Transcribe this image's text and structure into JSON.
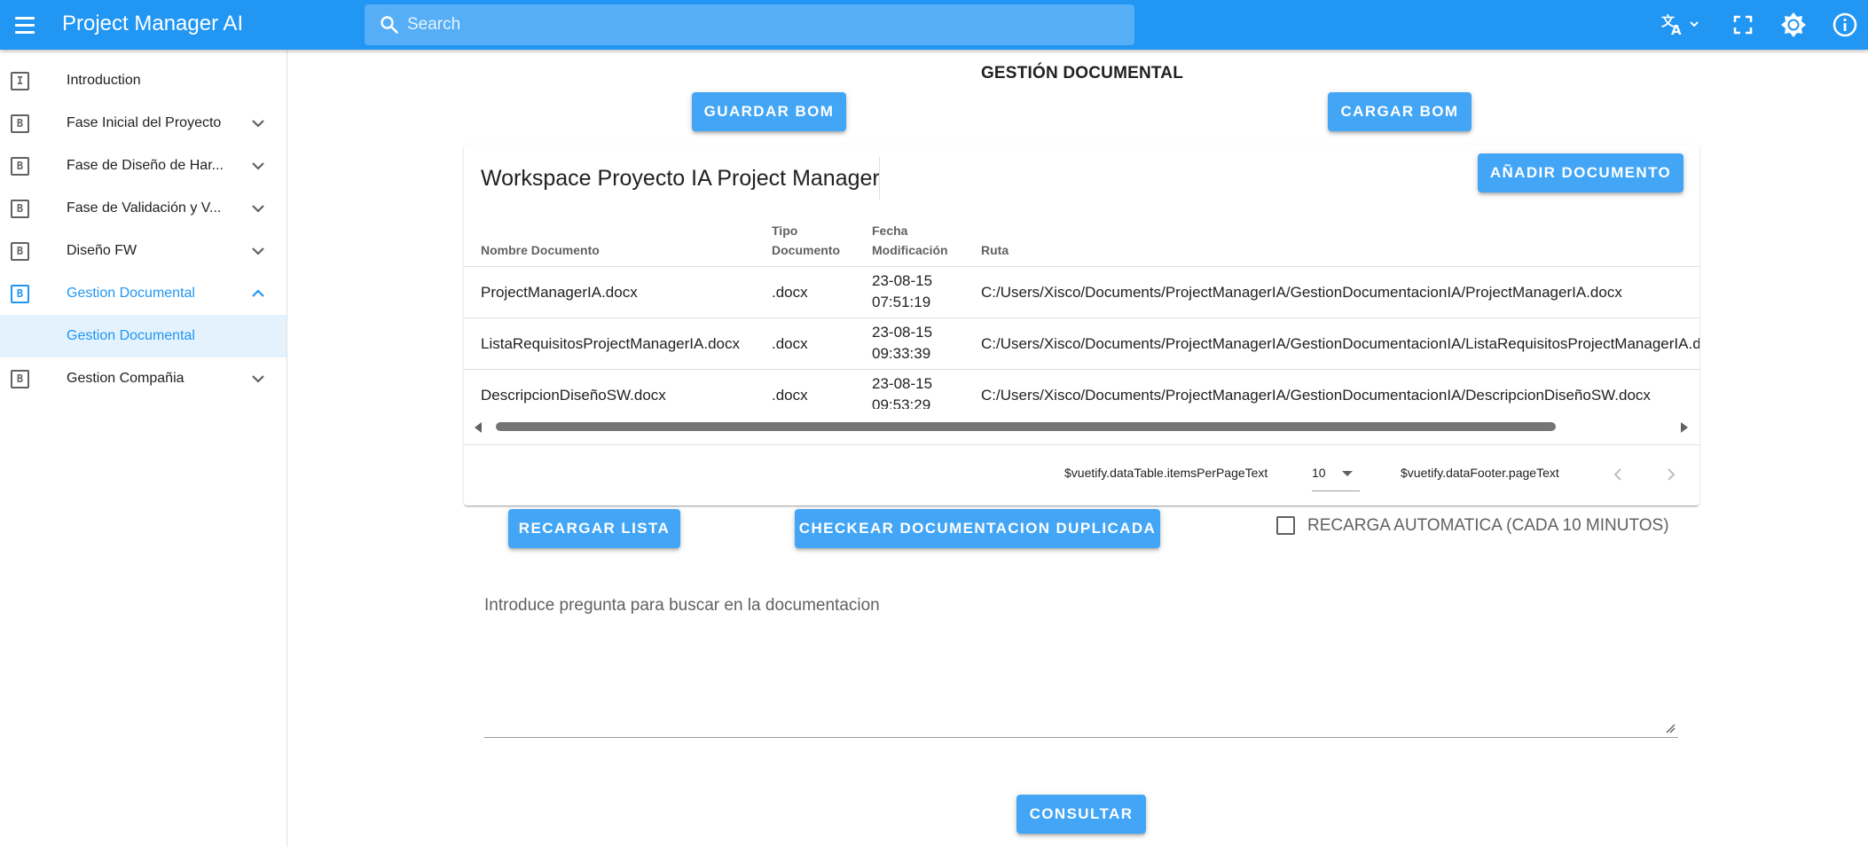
{
  "appbar": {
    "title": "Project Manager AI",
    "search_placeholder": "Search",
    "accent_color": "#2196f3",
    "icons": [
      "menu-icon",
      "translate-icon",
      "fullscreen-icon",
      "brightness-icon",
      "info-icon"
    ]
  },
  "sidebar": {
    "items": [
      {
        "icon": "I",
        "label": "Introduction"
      },
      {
        "icon": "B",
        "label": "Fase Inicial del Proyecto"
      },
      {
        "icon": "B",
        "label": "Fase de Diseño de Har..."
      },
      {
        "icon": "B",
        "label": "Fase de Validación y V..."
      },
      {
        "icon": "B",
        "label": "Diseño FW"
      },
      {
        "icon": "B",
        "label": "Gestion Documental"
      },
      {
        "icon": "B",
        "label": "Gestion Compañia"
      }
    ],
    "sub_item": {
      "label": "Gestion Documental"
    }
  },
  "main": {
    "title": "GESTIÓN DOCUMENTAL",
    "save_bom_label": "GUARDAR BOM",
    "load_bom_label": "CARGAR BOM",
    "workspace_title": "Workspace Proyecto IA Project Manager",
    "add_document_label": "AÑADIR DOCUMENTO",
    "table": {
      "headers": {
        "name": "Nombre Documento",
        "type_l1": "Tipo",
        "type_l2": "Documento",
        "date_l1": "Fecha",
        "date_l2": "Modificación",
        "path": "Ruta"
      },
      "rows": [
        {
          "name": "ProjectManagerIA.docx",
          "type": ".docx",
          "date": "23-08-15",
          "time": "07:51:19",
          "path": "C:/Users/Xisco/Documents/ProjectManagerIA/GestionDocumentacionIA/ProjectManagerIA.docx"
        },
        {
          "name": "ListaRequisitosProjectManagerIA.docx",
          "type": ".docx",
          "date": "23-08-15",
          "time": "09:33:39",
          "path": "C:/Users/Xisco/Documents/ProjectManagerIA/GestionDocumentacionIA/ListaRequisitosProjectManagerIA.docx"
        },
        {
          "name": "DescripcionDiseñoSW.docx",
          "type": ".docx",
          "date": "23-08-15",
          "time": "09:53:29",
          "path": "C:/Users/Xisco/Documents/ProjectManagerIA/GestionDocumentacionIA/DescripcionDiseñoSW.docx"
        }
      ]
    },
    "footer": {
      "items_per_page_text": "$vuetify.dataTable.itemsPerPageText",
      "items_per_page_value": "10",
      "page_text": "$vuetify.dataFooter.pageText"
    },
    "reload_list_label": "RECARGAR LISTA",
    "check_duplicates_label": "CHECKEAR DOCUMENTACION DUPLICADA",
    "auto_reload_label": "RECARGA AUTOMATICA (CADA 10 MINUTOS)",
    "auto_reload_checked": false,
    "question_placeholder": "Introduce pregunta para buscar en la documentacion",
    "consult_label": "CONSULTAR"
  }
}
